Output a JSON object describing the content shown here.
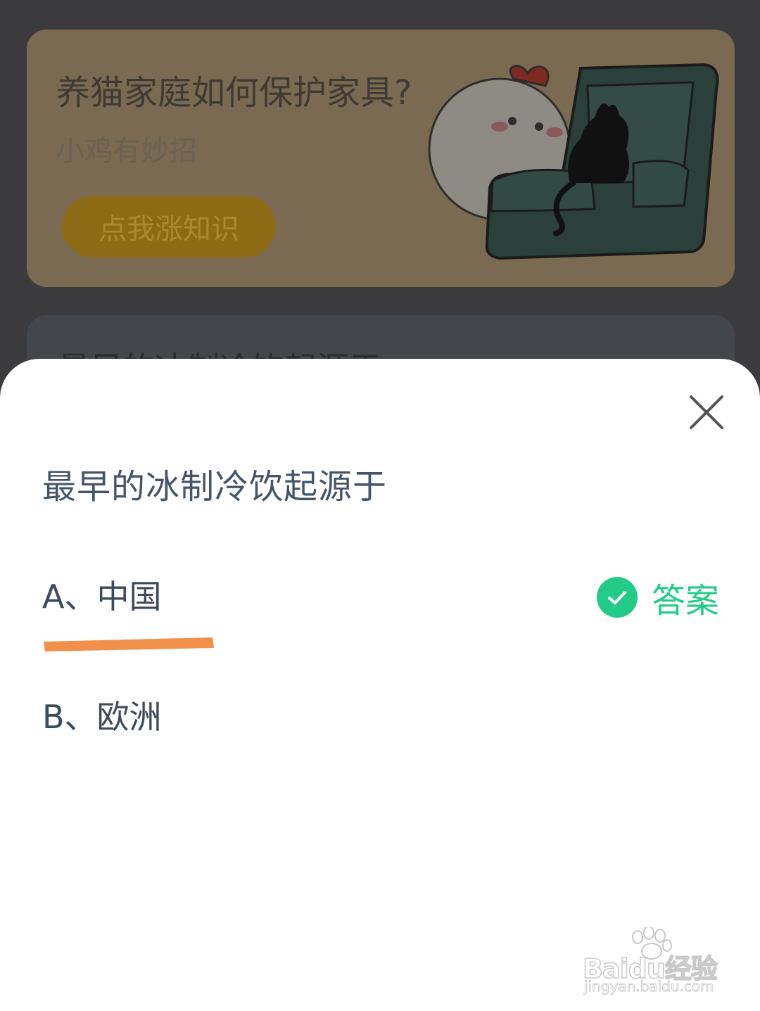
{
  "background_card": {
    "title": "养猫家庭如何保护家具?",
    "subtitle": "小鸡有妙招",
    "button_label": "点我涨知识"
  },
  "background_card2": {
    "title": "最早的冰制冷饮起源于"
  },
  "sheet": {
    "question": "最早的冰制冷饮起源于",
    "options": [
      {
        "label": "A、中国"
      },
      {
        "label": "B、欧洲"
      }
    ],
    "answer_label": "答案"
  },
  "watermark": {
    "brand": "Baidu经验",
    "url": "jingyan.baidu.com"
  },
  "colors": {
    "accent_green": "#22cc88",
    "underline_orange": "#f0904a",
    "question_text": "#44546a"
  },
  "icons": [
    "close-icon",
    "check-icon",
    "paw-icon"
  ]
}
